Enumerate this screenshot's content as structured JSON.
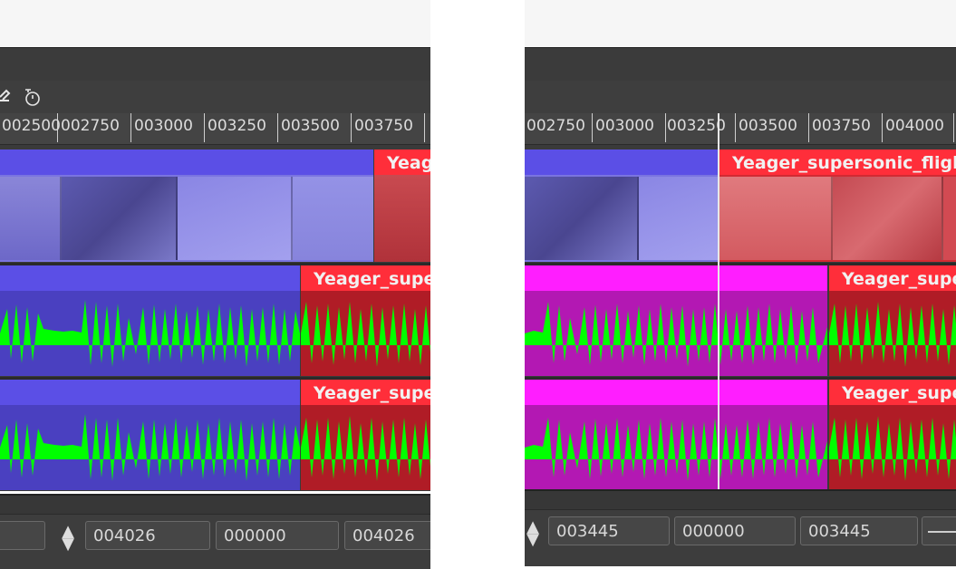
{
  "left_panel": {
    "ruler_labels": [
      "002500",
      "002750",
      "003000",
      "003250",
      "003500",
      "003750"
    ],
    "video_clip_label": "Yeager_supersonic_flight",
    "audio_clip_label_1": "Yeager_supersonic_flight",
    "audio_clip_label_2": "Yeager_supersonic_flight",
    "status_fields": {
      "position": "004026",
      "duration": "000000",
      "end": "004026"
    }
  },
  "right_panel": {
    "ruler_labels": [
      "002750",
      "003000",
      "003250",
      "003500",
      "003750",
      "004000"
    ],
    "video_clip_label": "Yeager_supersonic_flight",
    "audio_clip_label_1": "Yeager_supersonic_flight",
    "audio_clip_label_2": "Yeager_supersonic_flight",
    "status_fields": {
      "position": "003445",
      "duration": "000000",
      "end": "003445"
    }
  },
  "colors": {
    "selected_clip": "#5b4fe6",
    "unselected_clip": "#ff2e3a",
    "magenta_clip": "#ff1eff",
    "waveform": "#00ff00",
    "background": "#3a3a3a"
  },
  "icons": [
    "eject-arrow-icon",
    "timer-icon",
    "spin-arrows-icon"
  ]
}
